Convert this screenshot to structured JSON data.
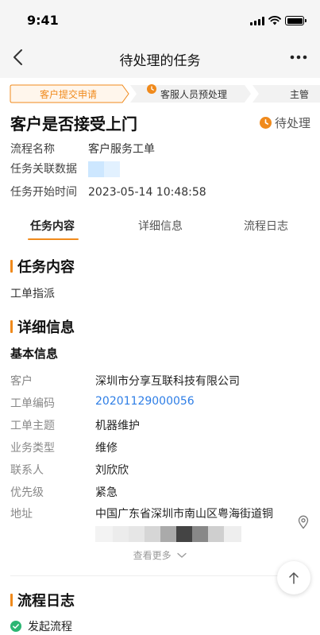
{
  "status_bar": {
    "time": "9:41"
  },
  "nav": {
    "title": "待处理的任务"
  },
  "steps": [
    {
      "label": "客户提交申请",
      "state": "current"
    },
    {
      "label": "客服人员预处理",
      "state": "pending"
    },
    {
      "label": "主管",
      "state": "pending"
    }
  ],
  "task": {
    "title": "客户是否接受上门",
    "status": "待处理"
  },
  "info": [
    {
      "key": "流程名称",
      "value": "客户服务工单"
    },
    {
      "key": "任务关联数据",
      "value": ""
    },
    {
      "key": "任务开始时间",
      "value": "2023-05-14 10:48:58"
    }
  ],
  "tabs": [
    {
      "label": "任务内容",
      "active": true
    },
    {
      "label": "详细信息",
      "active": false
    },
    {
      "label": "流程日志",
      "active": false
    }
  ],
  "task_content": {
    "heading": "任务内容",
    "text": "工单指派"
  },
  "detail": {
    "heading": "详细信息",
    "subheading": "基本信息",
    "rows": [
      {
        "key": "客户",
        "value": "深圳市分享互联科技有限公司"
      },
      {
        "key": "工单编码",
        "value": "20201129000056"
      },
      {
        "key": "工单主题",
        "value": "机器维护"
      },
      {
        "key": "业务类型",
        "value": "维修"
      },
      {
        "key": "联系人",
        "value": "刘欣欣"
      },
      {
        "key": "优先级",
        "value": "紧急"
      },
      {
        "key": "地址",
        "value": "中国广东省深圳市南山区粤海街道铜"
      }
    ],
    "see_more": "查看更多"
  },
  "log": {
    "heading": "流程日志",
    "items": [
      {
        "label": "发起流程"
      }
    ]
  },
  "colors": {
    "accent": "#f08a1c",
    "link": "#2e7ee6",
    "success": "#2cb673",
    "nav_bg": "#f5f5f5"
  },
  "icons": [
    "back-arrow-icon",
    "more-dots-icon",
    "clock-icon",
    "location-icon",
    "chevron-down-icon",
    "arrow-up-icon",
    "check-circle-icon"
  ]
}
